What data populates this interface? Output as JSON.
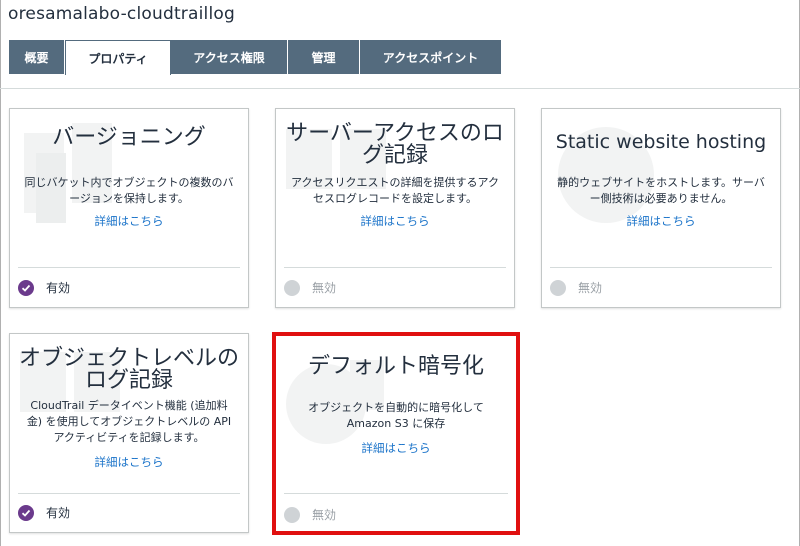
{
  "bucket": {
    "name": "oresamalabo-cloudtraillog"
  },
  "tabs": [
    {
      "label": "概要"
    },
    {
      "label": "プロパティ"
    },
    {
      "label": "アクセス権限"
    },
    {
      "label": "管理"
    },
    {
      "label": "アクセスポイント"
    }
  ],
  "active_tab": "プロパティ",
  "cards": {
    "versioning": {
      "title": "バージョニング",
      "description": "同じバケット内でオブジェクトの複数のバージョンを保持します。",
      "link": "詳細はこちら",
      "status": "有効"
    },
    "server_access_logging": {
      "title": "サーバーアクセスのログ記録",
      "description": "アクセスリクエストの詳細を提供するアクセスログレコードを設定します。",
      "link": "詳細はこちら",
      "status": "無効"
    },
    "static_website_hosting": {
      "title": "Static website hosting",
      "description": "静的ウェブサイトをホストします。サーバー側技術は必要ありません。",
      "link": "詳細はこちら",
      "status": "無効"
    },
    "object_level_logging": {
      "title": "オブジェクトレベルのログ記録",
      "description": "CloudTrail データイベント機能 (追加料金) を使用してオブジェクトレベルの API アクティビティを記録します。",
      "link": "詳細はこちら",
      "status": "有効"
    },
    "default_encryption": {
      "title": "デフォルト暗号化",
      "description": "オブジェクトを自動的に暗号化して Amazon S3 に保存",
      "link": "詳細はこちら",
      "status": "無効"
    }
  },
  "colors": {
    "tab_bg": "#546b7e",
    "enabled_check": "#6b3a8c",
    "link": "#1a73c9",
    "highlight_border": "#e01010"
  }
}
